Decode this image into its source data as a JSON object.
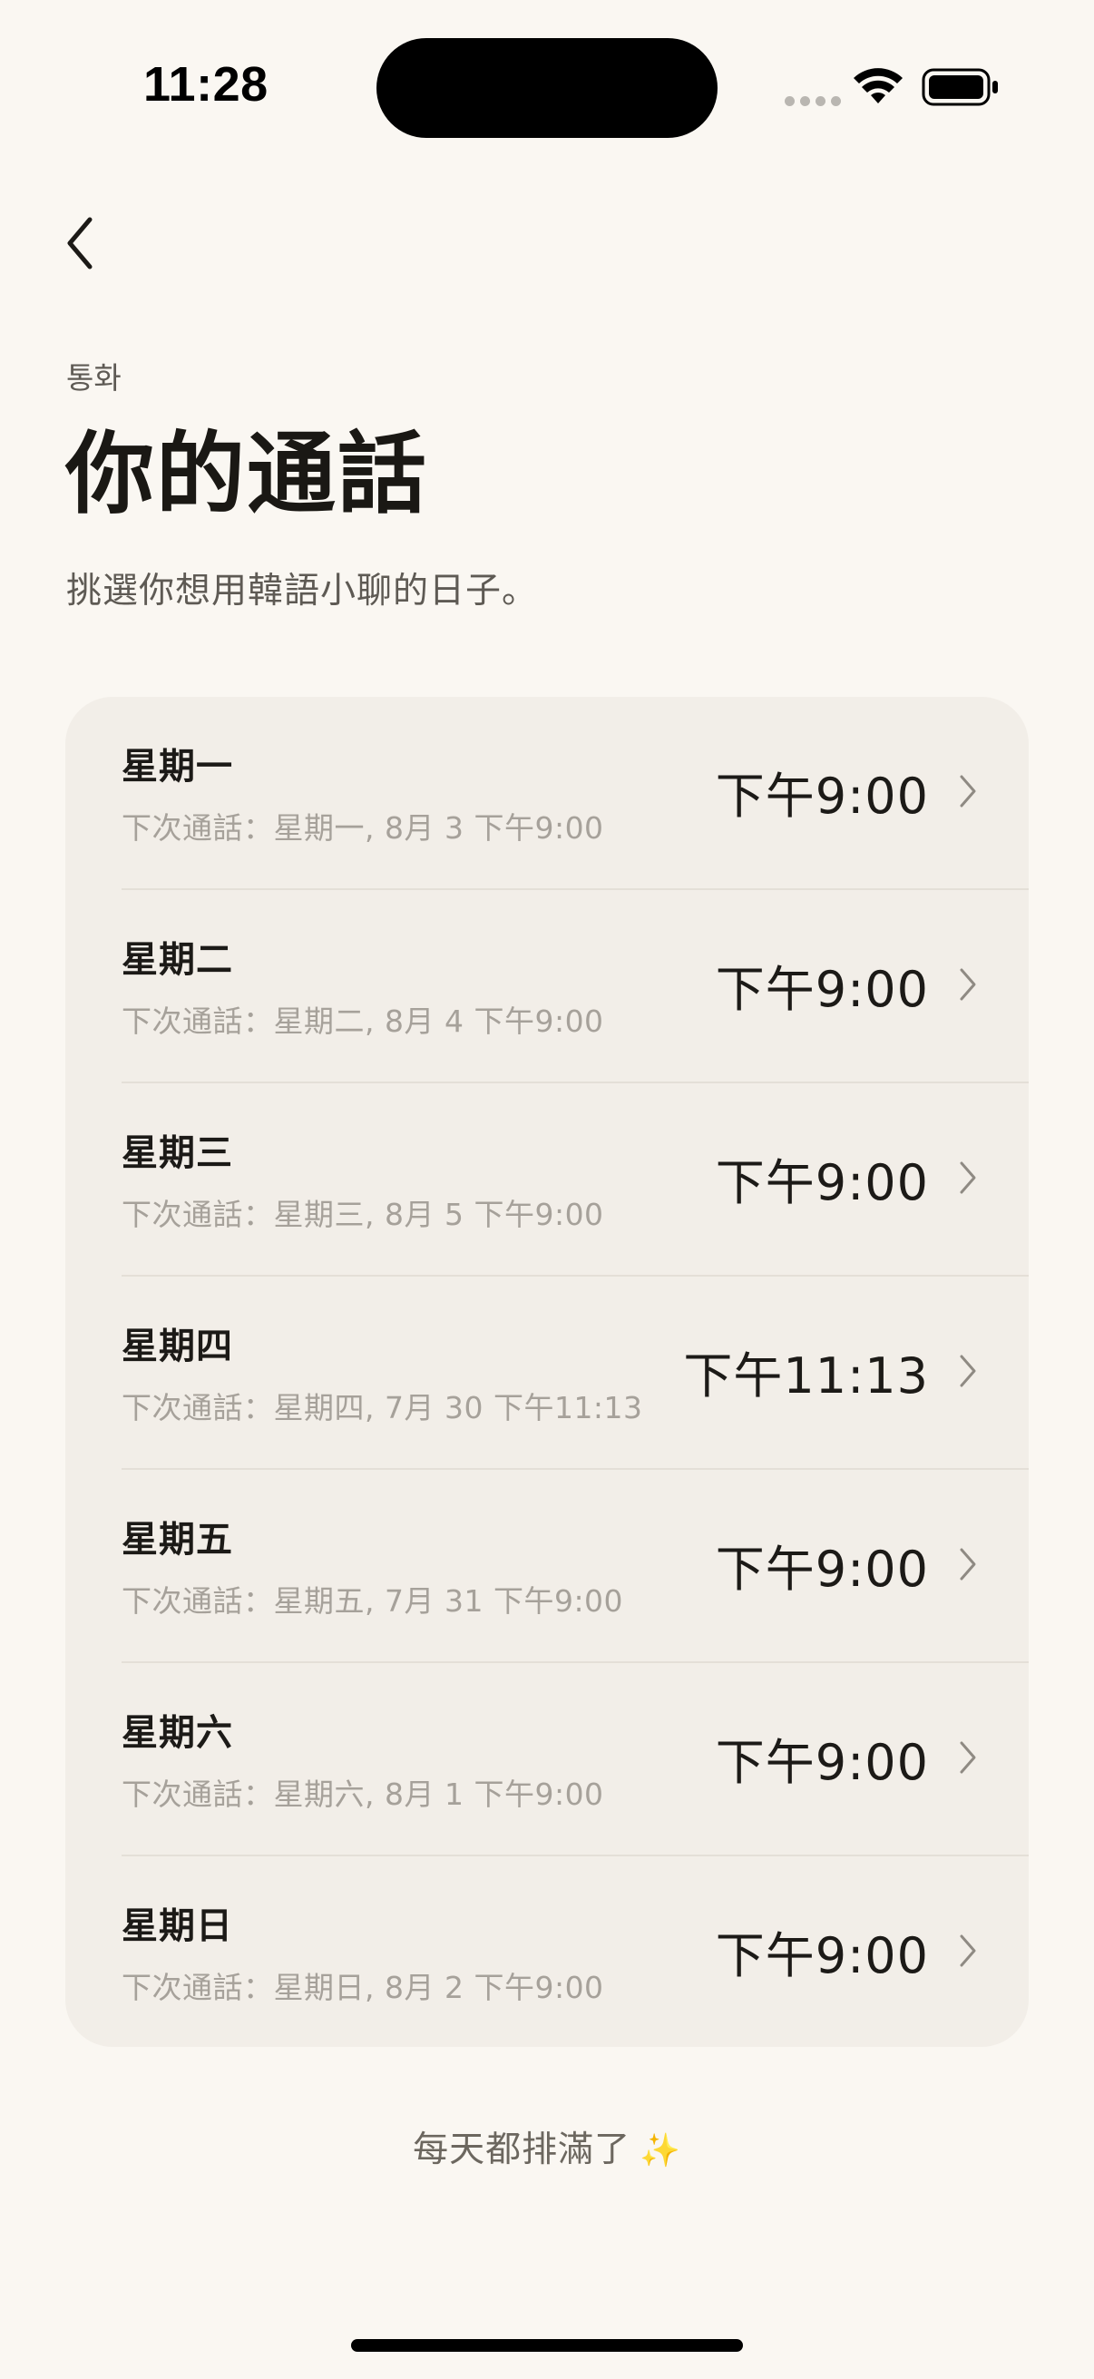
{
  "status_bar": {
    "time": "11:28"
  },
  "header": {
    "eyebrow": "통화",
    "title": "你的通話",
    "subtitle": "挑選你想用韓語小聊的日子。"
  },
  "schedule": {
    "rows": [
      {
        "day": "星期一",
        "next_call": "下次通話：星期一, 8月 3 下午9:00",
        "time": "下午9:00"
      },
      {
        "day": "星期二",
        "next_call": "下次通話：星期二, 8月 4 下午9:00",
        "time": "下午9:00"
      },
      {
        "day": "星期三",
        "next_call": "下次通話：星期三, 8月 5 下午9:00",
        "time": "下午9:00"
      },
      {
        "day": "星期四",
        "next_call": "下次通話：星期四, 7月 30 下午11:13",
        "time": "下午11:13"
      },
      {
        "day": "星期五",
        "next_call": "下次通話：星期五, 7月 31 下午9:00",
        "time": "下午9:00"
      },
      {
        "day": "星期六",
        "next_call": "下次通話：星期六, 8月 1 下午9:00",
        "time": "下午9:00"
      },
      {
        "day": "星期日",
        "next_call": "下次通話：星期日, 8月 2 下午9:00",
        "time": "下午9:00"
      }
    ]
  },
  "footer": {
    "note": "每天都排滿了",
    "emoji": "✨"
  },
  "icons": {
    "back": "chevron-left-icon",
    "row": "chevron-right-icon",
    "wifi": "wifi-icon",
    "battery": "battery-icon",
    "footer": "sparkles-icon"
  },
  "colors": {
    "background": "#FAF7F2",
    "card": "#F2EEE8",
    "text_primary": "#1C1A17",
    "text_secondary": "#5E5A54",
    "text_muted": "#A6A19A",
    "sparkle": "#F2C04A"
  }
}
